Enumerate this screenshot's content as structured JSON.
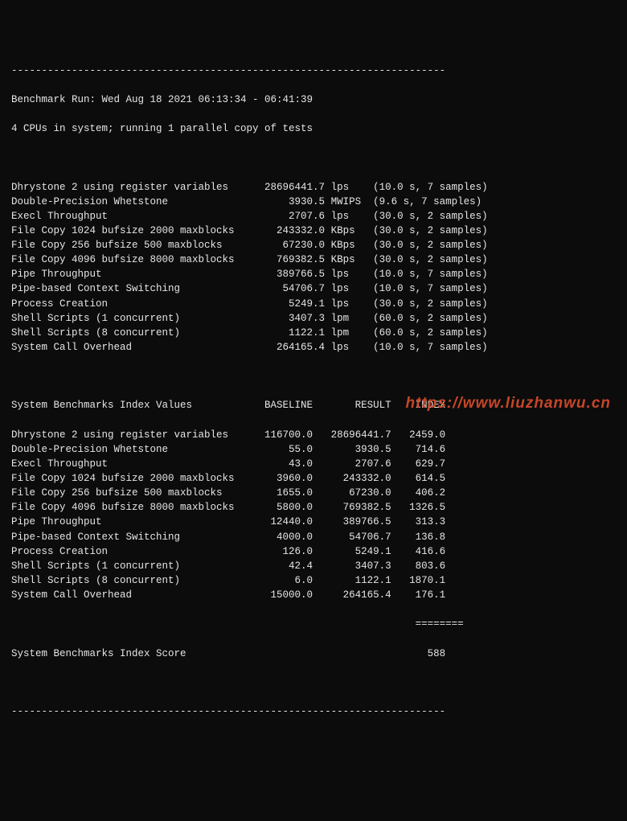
{
  "header": {
    "hr_top": "------------------------------------------------------------------------",
    "run_line": "Benchmark Run: Wed Aug 18 2021 06:13:34 - 06:41:39",
    "cpu_line": "4 CPUs in system; running 1 parallel copy of tests"
  },
  "results": [
    {
      "name": "Dhrystone 2 using register variables",
      "value": "28696441.7",
      "unit": "lps",
      "timing": "(10.0 s, 7 samples)"
    },
    {
      "name": "Double-Precision Whetstone",
      "value": "3930.5",
      "unit": "MWIPS",
      "timing": "(9.6 s, 7 samples)"
    },
    {
      "name": "Execl Throughput",
      "value": "2707.6",
      "unit": "lps",
      "timing": "(30.0 s, 2 samples)"
    },
    {
      "name": "File Copy 1024 bufsize 2000 maxblocks",
      "value": "243332.0",
      "unit": "KBps",
      "timing": "(30.0 s, 2 samples)"
    },
    {
      "name": "File Copy 256 bufsize 500 maxblocks",
      "value": "67230.0",
      "unit": "KBps",
      "timing": "(30.0 s, 2 samples)"
    },
    {
      "name": "File Copy 4096 bufsize 8000 maxblocks",
      "value": "769382.5",
      "unit": "KBps",
      "timing": "(30.0 s, 2 samples)"
    },
    {
      "name": "Pipe Throughput",
      "value": "389766.5",
      "unit": "lps",
      "timing": "(10.0 s, 7 samples)"
    },
    {
      "name": "Pipe-based Context Switching",
      "value": "54706.7",
      "unit": "lps",
      "timing": "(10.0 s, 7 samples)"
    },
    {
      "name": "Process Creation",
      "value": "5249.1",
      "unit": "lps",
      "timing": "(30.0 s, 2 samples)"
    },
    {
      "name": "Shell Scripts (1 concurrent)",
      "value": "3407.3",
      "unit": "lpm",
      "timing": "(60.0 s, 2 samples)"
    },
    {
      "name": "Shell Scripts (8 concurrent)",
      "value": "1122.1",
      "unit": "lpm",
      "timing": "(60.0 s, 2 samples)"
    },
    {
      "name": "System Call Overhead",
      "value": "264165.4",
      "unit": "lps",
      "timing": "(10.0 s, 7 samples)"
    }
  ],
  "index_header": {
    "label": "System Benchmarks Index Values",
    "baseline": "BASELINE",
    "result": "RESULT",
    "index": "INDEX"
  },
  "index": [
    {
      "name": "Dhrystone 2 using register variables",
      "baseline": "116700.0",
      "result": "28696441.7",
      "index": "2459.0"
    },
    {
      "name": "Double-Precision Whetstone",
      "baseline": "55.0",
      "result": "3930.5",
      "index": "714.6"
    },
    {
      "name": "Execl Throughput",
      "baseline": "43.0",
      "result": "2707.6",
      "index": "629.7"
    },
    {
      "name": "File Copy 1024 bufsize 2000 maxblocks",
      "baseline": "3960.0",
      "result": "243332.0",
      "index": "614.5"
    },
    {
      "name": "File Copy 256 bufsize 500 maxblocks",
      "baseline": "1655.0",
      "result": "67230.0",
      "index": "406.2"
    },
    {
      "name": "File Copy 4096 bufsize 8000 maxblocks",
      "baseline": "5800.0",
      "result": "769382.5",
      "index": "1326.5"
    },
    {
      "name": "Pipe Throughput",
      "baseline": "12440.0",
      "result": "389766.5",
      "index": "313.3"
    },
    {
      "name": "Pipe-based Context Switching",
      "baseline": "4000.0",
      "result": "54706.7",
      "index": "136.8"
    },
    {
      "name": "Process Creation",
      "baseline": "126.0",
      "result": "5249.1",
      "index": "416.6"
    },
    {
      "name": "Shell Scripts (1 concurrent)",
      "baseline": "42.4",
      "result": "3407.3",
      "index": "803.6"
    },
    {
      "name": "Shell Scripts (8 concurrent)",
      "baseline": "6.0",
      "result": "1122.1",
      "index": "1870.1"
    },
    {
      "name": "System Call Overhead",
      "baseline": "15000.0",
      "result": "264165.4",
      "index": "176.1"
    }
  ],
  "index_sep": "                                                                   ========",
  "score": {
    "label": "System Benchmarks Index Score",
    "value": "588"
  },
  "hr_bottom": "------------------------------------------------------------------------",
  "watermark": "https://www.liuzhanwu.cn"
}
